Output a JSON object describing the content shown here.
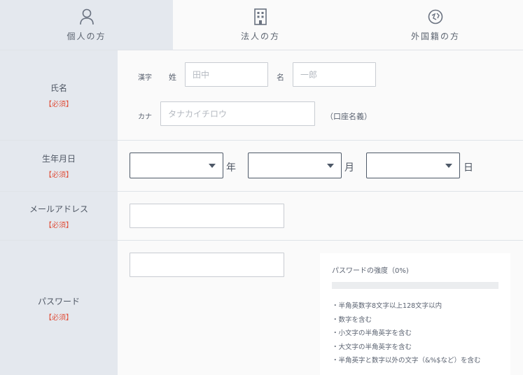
{
  "tabs": [
    {
      "label": "個人の方",
      "icon": "person-icon",
      "active": true
    },
    {
      "label": "法人の方",
      "icon": "building-icon",
      "active": false
    },
    {
      "label": "外国籍の方",
      "icon": "foreign-icon",
      "active": false
    }
  ],
  "required_label": "【必須】",
  "name": {
    "label": "氏名",
    "kanji_label": "漢字",
    "sei_label": "姓",
    "sei_placeholder": "田中",
    "mei_label": "名",
    "mei_placeholder": "一郎",
    "kana_label": "カナ",
    "kana_placeholder": "タナカイチロウ",
    "kana_note": "（口座名義）"
  },
  "birth": {
    "label": "生年月日",
    "year_unit": "年",
    "month_unit": "月",
    "day_unit": "日"
  },
  "email": {
    "label": "メールアドレス"
  },
  "password": {
    "label": "パスワード",
    "strength_title": "パスワードの強度（0%)",
    "strength_value": 0,
    "rules": [
      "・半角英数字8文字以上128文字以内",
      "・数字を含む",
      "・小文字の半角英字を含む",
      "・大文字の半角英字を含む",
      "・半角英字と数字以外の文字（&%$など）を含む"
    ]
  }
}
